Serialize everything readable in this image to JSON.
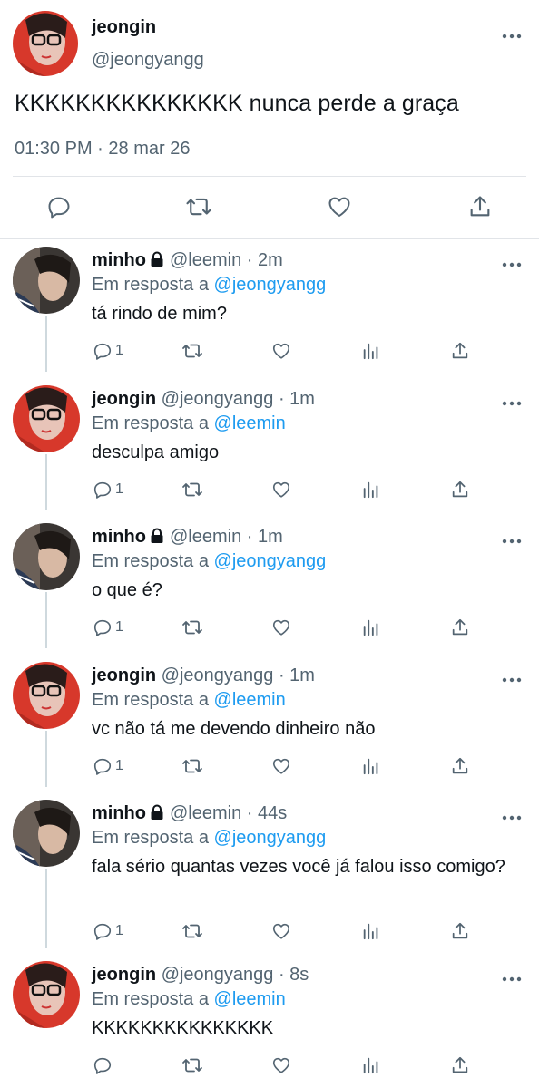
{
  "main_tweet": {
    "name": "jeongin",
    "handle": "@jeongyangg",
    "text": "KKKKKKKKKKKKKKK nunca perde a graça",
    "time": "01:30 PM",
    "separator": "·",
    "date": "28 mar 26"
  },
  "replies": [
    {
      "name": "minho",
      "locked": true,
      "handle": "@leemin",
      "time": "· 2m",
      "in_reply_prefix": "Em resposta a",
      "in_reply_to": "@jeongyangg",
      "text": "tá rindo de mim?",
      "reply_count": "1",
      "avatar": "minho"
    },
    {
      "name": "jeongin",
      "locked": false,
      "handle": "@jeongyangg",
      "time": "· 1m",
      "in_reply_prefix": "Em resposta a",
      "in_reply_to": "@leemin",
      "text": "desculpa amigo",
      "reply_count": "1",
      "avatar": "jeongin"
    },
    {
      "name": "minho",
      "locked": true,
      "handle": "@leemin",
      "time": "· 1m",
      "in_reply_prefix": "Em resposta a",
      "in_reply_to": "@jeongyangg",
      "text": "o que é?",
      "reply_count": "1",
      "avatar": "minho"
    },
    {
      "name": "jeongin",
      "locked": false,
      "handle": "@jeongyangg",
      "time": "· 1m",
      "in_reply_prefix": "Em resposta a",
      "in_reply_to": "@leemin",
      "text": "vc não tá me devendo dinheiro não",
      "reply_count": "1",
      "avatar": "jeongin"
    },
    {
      "name": "minho",
      "locked": true,
      "handle": "@leemin",
      "time": "· 44s",
      "in_reply_prefix": "Em resposta a",
      "in_reply_to": "@jeongyangg",
      "text": "fala sério quantas vezes você já falou isso comigo?",
      "reply_count": "1",
      "avatar": "minho"
    },
    {
      "name": "jeongin",
      "locked": false,
      "handle": "@jeongyangg",
      "time": "· 8s",
      "in_reply_prefix": "Em resposta a",
      "in_reply_to": "@leemin",
      "text": "KKKKKKKKKKKKKKK",
      "reply_count": "",
      "avatar": "jeongin"
    }
  ],
  "icons": {
    "reply": "reply-icon",
    "retweet": "retweet-icon",
    "like": "like-icon",
    "views": "views-icon",
    "share": "share-icon",
    "more": "more-icon",
    "lock": "lock-icon"
  },
  "colors": {
    "text": "#0f1419",
    "secondary": "#536471",
    "link": "#1d9bf0",
    "thread_line": "#cfd9de",
    "divider": "#e1e4e8"
  }
}
